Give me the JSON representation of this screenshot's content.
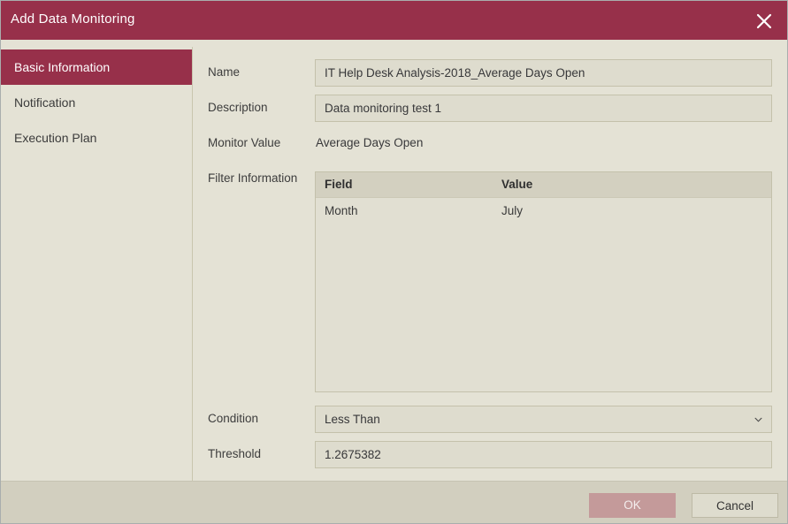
{
  "dialog": {
    "title": "Add Data Monitoring",
    "close_icon": "close-icon"
  },
  "sidebar": {
    "items": [
      {
        "label": "Basic Information",
        "active": true
      },
      {
        "label": "Notification",
        "active": false
      },
      {
        "label": "Execution Plan",
        "active": false
      }
    ]
  },
  "form": {
    "name": {
      "label": "Name",
      "value": "IT Help Desk Analysis-2018_Average Days Open"
    },
    "description": {
      "label": "Description",
      "value": "Data monitoring test 1"
    },
    "monitor_value": {
      "label": "Monitor Value",
      "value": "Average Days Open"
    },
    "filter_information": {
      "label": "Filter Information",
      "columns": [
        "Field",
        "Value"
      ],
      "rows": [
        {
          "field": "Month",
          "value": "July"
        }
      ]
    },
    "condition": {
      "label": "Condition",
      "value": "Less Than",
      "chevron_icon": "chevron-down-icon"
    },
    "threshold": {
      "label": "Threshold",
      "value": "1.2675382"
    }
  },
  "footer": {
    "ok_label": "OK",
    "cancel_label": "Cancel"
  },
  "colors": {
    "accent": "#97304a",
    "background": "#e4e2d5",
    "footer": "#d2cfbf",
    "field": "#dedcce",
    "ok_button": "#c49a9a"
  }
}
